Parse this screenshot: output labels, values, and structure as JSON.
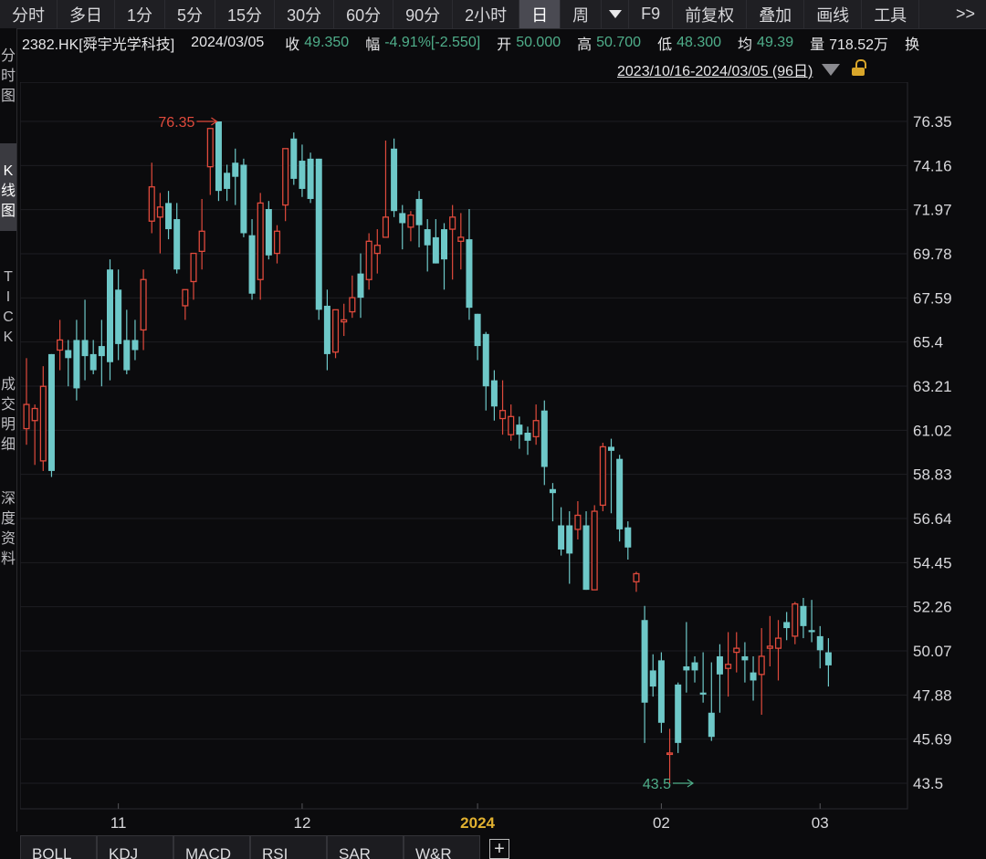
{
  "toolbar": {
    "items": [
      "分时",
      "多日",
      "1分",
      "5分",
      "15分",
      "30分",
      "60分",
      "90分",
      "2小时",
      "日",
      "周"
    ],
    "active": "日",
    "f9": "F9",
    "adjust": "前复权",
    "overlay": "叠加",
    "draw": "画线",
    "tools": "工具",
    "more": ">>"
  },
  "info": {
    "symbol": "2382.HK[舜宇光学科技]",
    "date": "2024/03/05",
    "close_label": "收",
    "close": "49.350",
    "change_label": "幅",
    "change": "-4.91%[-2.550]",
    "open_label": "开",
    "open": "50.000",
    "high_label": "高",
    "high": "50.700",
    "low_label": "低",
    "low": "48.300",
    "avg_label": "均",
    "avg": "49.39",
    "volume_label": "量",
    "volume": "718.52万",
    "turnover_label": "换"
  },
  "range": {
    "text": "2023/10/16-2024/03/05 (96日)"
  },
  "sidebar": {
    "tabs": [
      {
        "label": "分时图",
        "active": false
      },
      {
        "label": "K线图",
        "active": true
      },
      {
        "label": "TICK",
        "active": false
      },
      {
        "label": "成交明细",
        "active": false
      },
      {
        "label": "深度资料",
        "active": false
      }
    ]
  },
  "indicators": [
    "BOLL",
    "KDJ",
    "MACD",
    "RSI",
    "SAR",
    "W&R"
  ],
  "colors": {
    "up": "#e04a3c",
    "down": "#6ec8c8",
    "grid": "#1e1e22",
    "axis_text": "#d8d8db"
  },
  "chart_data": {
    "type": "candlestick",
    "y_ticks": [
      "76.35",
      "74.16",
      "71.97",
      "69.78",
      "67.59",
      "65.4",
      "63.21",
      "61.02",
      "58.83",
      "56.64",
      "54.45",
      "52.26",
      "50.07",
      "47.88",
      "45.69",
      "43.5"
    ],
    "ylim": [
      43.5,
      76.35
    ],
    "x_ticks": [
      {
        "label": "11",
        "index": 11,
        "highlight": false
      },
      {
        "label": "12",
        "index": 33,
        "highlight": false
      },
      {
        "label": "2024",
        "index": 54,
        "highlight": true
      },
      {
        "label": "02",
        "index": 76,
        "highlight": false
      },
      {
        "label": "03",
        "index": 95,
        "highlight": false
      }
    ],
    "annotations": [
      {
        "text": "76.35",
        "index": 23,
        "value": 76.35,
        "color": "up",
        "kind": "max"
      },
      {
        "text": "43.5",
        "index": 80,
        "value": 43.5,
        "color": "down",
        "kind": "min"
      }
    ],
    "candles": [
      [
        61.1,
        64.6,
        60.3,
        62.3
      ],
      [
        61.5,
        62.3,
        59.3,
        62.1
      ],
      [
        59.5,
        64.2,
        59.0,
        63.2
      ],
      [
        64.8,
        64.8,
        58.7,
        59.0
      ],
      [
        65.0,
        66.5,
        64.0,
        65.5
      ],
      [
        65.0,
        65.5,
        63.2,
        64.6
      ],
      [
        65.5,
        66.5,
        62.5,
        63.1
      ],
      [
        65.5,
        67.5,
        63.5,
        64.7
      ],
      [
        64.8,
        65.5,
        63.8,
        64.0
      ],
      [
        65.2,
        66.5,
        63.2,
        64.7
      ],
      [
        69.0,
        69.5,
        63.5,
        64.4
      ],
      [
        68.0,
        69.0,
        64.5,
        65.3
      ],
      [
        65.5,
        67.0,
        63.8,
        64.0
      ],
      [
        65.5,
        66.5,
        64.5,
        65.0
      ],
      [
        66.0,
        69.0,
        65.0,
        68.5
      ],
      [
        71.4,
        74.3,
        70.8,
        73.1
      ],
      [
        71.6,
        72.8,
        69.8,
        72.1
      ],
      [
        72.3,
        72.9,
        70.5,
        71.0
      ],
      [
        71.5,
        72.3,
        68.8,
        69.0
      ],
      [
        67.2,
        67.8,
        66.5,
        68.0
      ],
      [
        68.4,
        69.5,
        67.5,
        69.8
      ],
      [
        69.9,
        72.5,
        69.0,
        70.9
      ],
      [
        74.1,
        76.0,
        72.7,
        76.0
      ],
      [
        76.35,
        76.35,
        72.4,
        72.9
      ],
      [
        73.8,
        74.2,
        72.4,
        73.0
      ],
      [
        74.3,
        75.0,
        72.2,
        73.6
      ],
      [
        74.2,
        74.5,
        70.6,
        70.8
      ],
      [
        70.7,
        71.5,
        67.5,
        67.8
      ],
      [
        68.5,
        72.8,
        67.5,
        72.3
      ],
      [
        72.0,
        72.4,
        69.5,
        69.7
      ],
      [
        69.8,
        71.2,
        69.3,
        70.9
      ],
      [
        72.2,
        74.9,
        71.4,
        75.0
      ],
      [
        75.5,
        75.8,
        73.2,
        73.5
      ],
      [
        74.4,
        75.2,
        72.6,
        73.0
      ],
      [
        74.5,
        74.8,
        72.3,
        72.5
      ],
      [
        74.5,
        74.5,
        66.5,
        67.0
      ],
      [
        67.2,
        68.0,
        64.0,
        64.8
      ],
      [
        64.9,
        67.0,
        64.6,
        67.0
      ],
      [
        66.4,
        67.3,
        65.7,
        66.5
      ],
      [
        66.9,
        68.7,
        66.6,
        67.6
      ],
      [
        68.8,
        69.8,
        66.6,
        67.6
      ],
      [
        68.5,
        70.8,
        68.0,
        70.4
      ],
      [
        69.8,
        71.0,
        68.8,
        70.2
      ],
      [
        70.6,
        75.4,
        71.6,
        71.6
      ],
      [
        75.0,
        75.5,
        71.6,
        71.9
      ],
      [
        71.8,
        72.2,
        70.0,
        71.3
      ],
      [
        71.1,
        71.9,
        70.4,
        71.7
      ],
      [
        72.5,
        72.9,
        70.1,
        71.2
      ],
      [
        71.0,
        71.5,
        68.9,
        70.2
      ],
      [
        70.6,
        71.5,
        69.5,
        69.3
      ],
      [
        71.0,
        71.3,
        68.0,
        69.5
      ],
      [
        71.0,
        72.2,
        68.5,
        71.6
      ],
      [
        70.4,
        71.8,
        69.0,
        70.6
      ],
      [
        70.5,
        72.0,
        66.5,
        67.1
      ],
      [
        66.8,
        66.8,
        64.5,
        65.2
      ],
      [
        65.8,
        65.9,
        62.0,
        63.2
      ],
      [
        63.5,
        64.0,
        61.5,
        62.2
      ],
      [
        61.6,
        63.5,
        60.8,
        62.0
      ],
      [
        60.8,
        62.3,
        60.5,
        61.7
      ],
      [
        61.3,
        61.7,
        60.1,
        60.8
      ],
      [
        60.9,
        61.2,
        59.8,
        60.5
      ],
      [
        60.7,
        62.3,
        60.3,
        61.5
      ],
      [
        62.0,
        62.5,
        58.3,
        59.2
      ],
      [
        58.1,
        58.4,
        56.5,
        57.9
      ],
      [
        56.3,
        57.2,
        54.8,
        55.1
      ],
      [
        56.3,
        57.0,
        53.4,
        54.9
      ],
      [
        56.1,
        57.5,
        55.6,
        56.8
      ],
      [
        56.3,
        57.0,
        53.5,
        53.1
      ],
      [
        53.1,
        57.3,
        53.3,
        57.0
      ],
      [
        57.3,
        60.4,
        57.0,
        60.2
      ],
      [
        60.2,
        60.6,
        56.9,
        60.0
      ],
      [
        59.6,
        59.8,
        55.5,
        56.1
      ],
      [
        56.2,
        56.5,
        54.6,
        55.2
      ],
      [
        53.5,
        54.0,
        53.0,
        53.9
      ],
      [
        51.6,
        52.3,
        45.5,
        47.5
      ],
      [
        49.1,
        49.9,
        47.8,
        48.3
      ],
      [
        49.6,
        50.0,
        46.0,
        46.5
      ],
      [
        45.0,
        46.2,
        43.5,
        45.0
      ],
      [
        48.4,
        48.5,
        45.0,
        45.5
      ],
      [
        49.3,
        51.5,
        48.0,
        49.1
      ],
      [
        49.5,
        49.8,
        48.5,
        49.1
      ],
      [
        48.0,
        50.0,
        47.5,
        47.9
      ],
      [
        47.0,
        49.5,
        45.6,
        45.8
      ],
      [
        49.8,
        50.4,
        47.0,
        48.9
      ],
      [
        49.2,
        51.0,
        47.8,
        49.4
      ],
      [
        50.0,
        51.0,
        49.0,
        50.2
      ],
      [
        49.8,
        50.5,
        48.5,
        49.6
      ],
      [
        49.0,
        49.8,
        47.6,
        48.6
      ],
      [
        48.9,
        51.2,
        46.9,
        49.8
      ],
      [
        50.2,
        51.8,
        49.3,
        50.3
      ],
      [
        50.2,
        51.6,
        48.6,
        50.7
      ],
      [
        51.5,
        52.0,
        50.6,
        51.2
      ],
      [
        50.8,
        52.5,
        50.4,
        52.4
      ],
      [
        52.3,
        52.7,
        50.7,
        51.3
      ],
      [
        51.1,
        52.6,
        50.5,
        51.0
      ],
      [
        50.8,
        51.3,
        49.2,
        50.1
      ],
      [
        50.0,
        50.7,
        48.3,
        49.35
      ]
    ]
  }
}
